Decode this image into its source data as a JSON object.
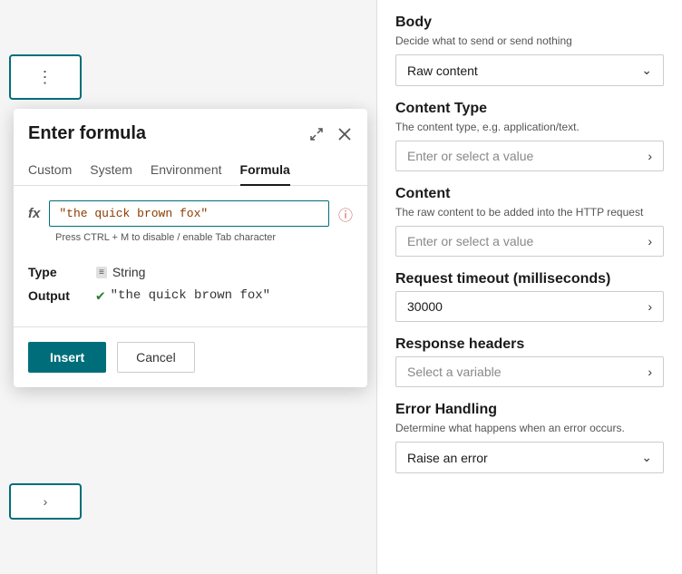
{
  "dialog": {
    "title": "Enter formula",
    "tabs": [
      {
        "id": "custom",
        "label": "Custom"
      },
      {
        "id": "system",
        "label": "System"
      },
      {
        "id": "environment",
        "label": "Environment"
      },
      {
        "id": "formula",
        "label": "Formula"
      }
    ],
    "active_tab": "formula",
    "formula_value": "\"the quick brown fox\"",
    "hint": "Press CTRL + M to disable / enable Tab character",
    "type_label": "Type",
    "type_value": "String",
    "output_label": "Output",
    "output_value": "\"the quick brown fox\"",
    "insert_label": "Insert",
    "cancel_label": "Cancel"
  },
  "right_panel": {
    "body": {
      "label": "Body",
      "desc": "Decide what to send or send nothing",
      "dropdown_value": "Raw content"
    },
    "content_type": {
      "label": "Content Type",
      "desc": "The content type, e.g. application/text.",
      "placeholder": "Enter or select a value"
    },
    "content": {
      "label": "Content",
      "desc": "The raw content to be added into the HTTP request",
      "placeholder": "Enter or select a value"
    },
    "request_timeout": {
      "label": "Request timeout (milliseconds)",
      "value": "30000"
    },
    "response_headers": {
      "label": "Response headers",
      "placeholder": "Select a variable"
    },
    "error_handling": {
      "label": "Error Handling",
      "desc": "Determine what happens when an error occurs.",
      "dropdown_value": "Raise an error"
    }
  }
}
